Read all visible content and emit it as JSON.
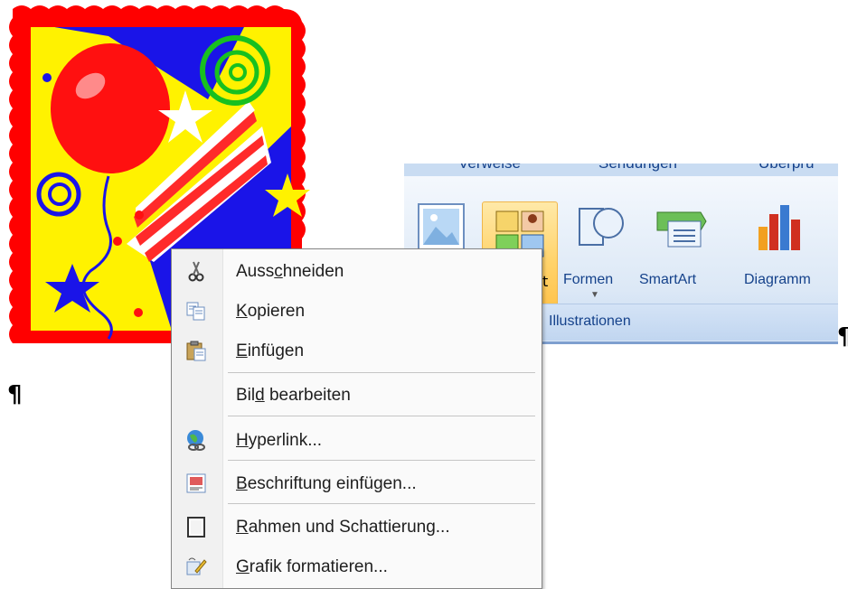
{
  "ribbon": {
    "tabs": [
      "Verweise",
      "Sendungen",
      "Überprü"
    ],
    "buttons": {
      "grafik_label": "",
      "clipart_label": "t",
      "formen_label": "Formen",
      "smartart_label": "SmartArt",
      "diagramm_label": "Diagramm"
    },
    "group_label": "Illustrationen"
  },
  "context_menu": {
    "items": [
      {
        "pre": "Auss",
        "key": "c",
        "post": "hneiden",
        "icon": "scissors-icon"
      },
      {
        "pre": "",
        "key": "K",
        "post": "opieren",
        "icon": "copy-icon"
      },
      {
        "pre": "",
        "key": "E",
        "post": "infügen",
        "icon": "paste-icon"
      },
      {
        "pre": "Bil",
        "key": "d",
        "post": " bearbeiten",
        "icon": ""
      },
      {
        "pre": "",
        "key": "H",
        "post": "yperlink...",
        "icon": "hyperlink-globe-icon"
      },
      {
        "pre": "",
        "key": "B",
        "post": "eschriftung einfügen...",
        "icon": "caption-icon"
      },
      {
        "pre": "",
        "key": "R",
        "post": "ahmen und Schattierung...",
        "icon": "borders-icon"
      },
      {
        "pre": "",
        "key": "G",
        "post": "rafik formatieren...",
        "icon": "format-picture-icon"
      }
    ]
  },
  "document": {
    "pilcrow": "¶"
  },
  "colors": {
    "menu_border": "#868686",
    "ribbon_text": "#15428b",
    "clipart_frame": "#ff0000",
    "clipart_blue": "#1a14e8",
    "clipart_yellow": "#fff200"
  }
}
